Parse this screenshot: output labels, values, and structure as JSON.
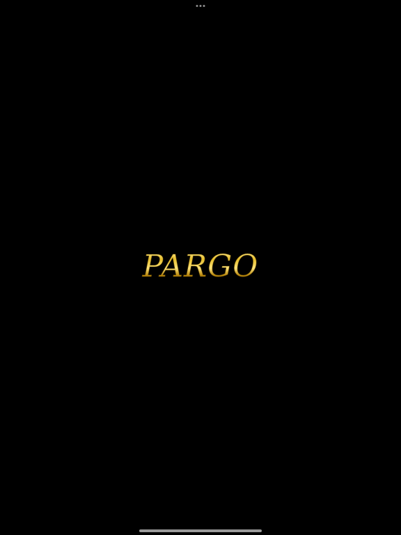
{
  "app": {
    "logo_text": "PARGO"
  },
  "colors": {
    "background": "#000000",
    "logo_gold_light": "#fff2a8",
    "logo_gold_mid": "#e6be2c",
    "logo_gold_dark": "#7a5a08",
    "indicator": "#9a9a9a"
  },
  "icons": {
    "top": "multitasking-dots-icon",
    "bottom": "home-indicator"
  }
}
